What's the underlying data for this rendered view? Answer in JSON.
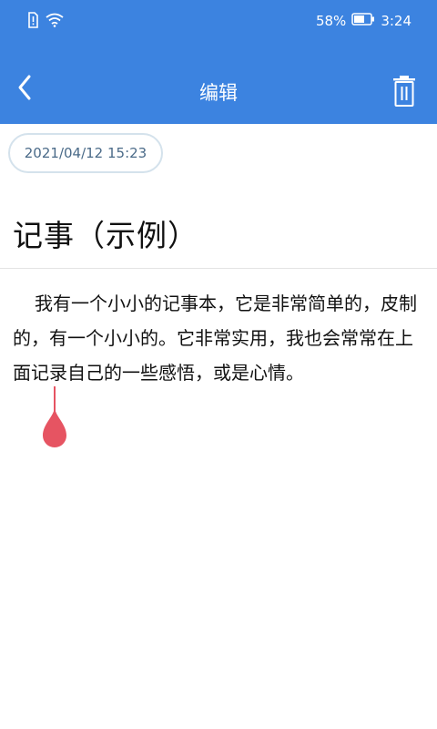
{
  "status_bar": {
    "battery_text": "58%",
    "time": "3:24",
    "icons": [
      "alert-sim-icon",
      "wifi-icon",
      "battery-icon"
    ]
  },
  "header": {
    "title": "编辑",
    "back_icon": "chevron-left-icon",
    "delete_icon": "trash-icon"
  },
  "note": {
    "date": "2021/04/12 15:23",
    "title": "记事（示例）",
    "body": "我有一个小小的记事本，它是非常简单的，皮制的，有一个小小的。它非常实用，我也会常常在上面记录自己的一些感悟，或是心情。"
  },
  "colors": {
    "header_bg": "#3c83e0",
    "cursor": "#e65462",
    "date_border": "#d4e2ec"
  }
}
